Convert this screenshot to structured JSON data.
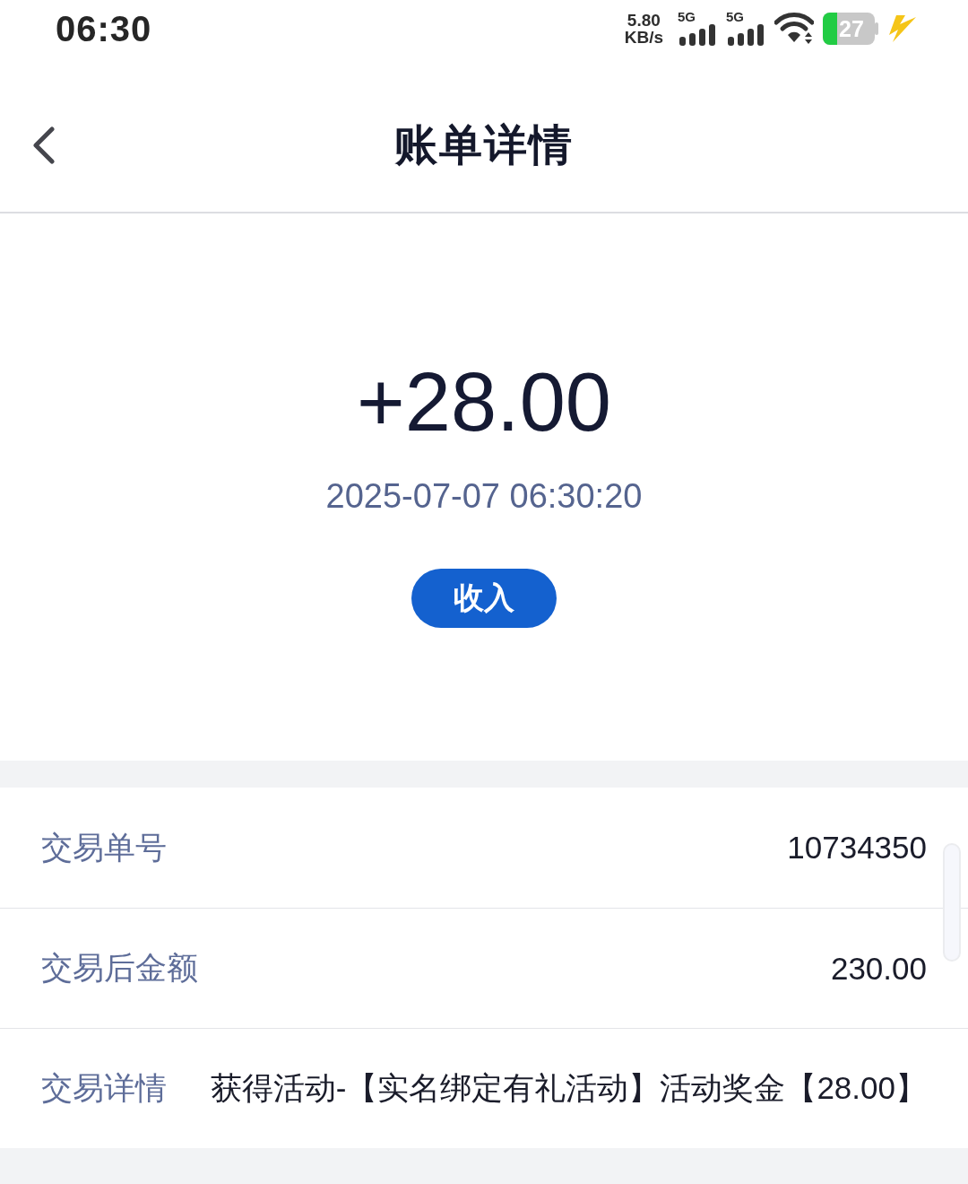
{
  "status_bar": {
    "time": "06:30",
    "net_speed": {
      "value": "5.80",
      "unit": "KB/s"
    },
    "signals": [
      {
        "label": "5G"
      },
      {
        "label": "5G"
      }
    ],
    "battery": "27"
  },
  "header": {
    "title": "账单详情"
  },
  "summary": {
    "amount": "+28.00",
    "datetime": "2025-07-07 06:30:20",
    "badge": "收入"
  },
  "details": [
    {
      "label": "交易单号",
      "value": "10734350"
    },
    {
      "label": "交易后金额",
      "value": "230.00"
    },
    {
      "label": "交易详情",
      "value": "获得活动-【实名绑定有礼活动】活动奖金【28.00】"
    }
  ]
}
